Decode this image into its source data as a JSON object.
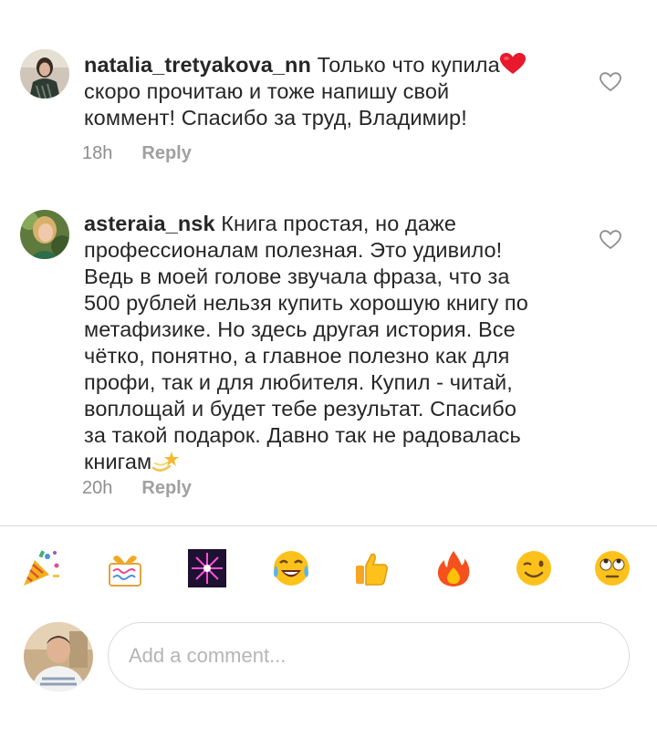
{
  "comments": [
    {
      "username": "natalia_tretyakova_nn",
      "text": " Только что купила",
      "text_emoji": "heart",
      "text_cont_lines": [
        "скоро прочитаю и тоже напишу свой",
        "коммент! Спасибо за труд, Владимир!"
      ],
      "time": "18h",
      "reply": "Reply"
    },
    {
      "username": "asteraia_nsk",
      "text_first": " Книга простая, но даже",
      "text_lines": [
        "профессионалам полезная. Это удивило!",
        "Ведь в моей голове звучала фраза, что за",
        "500 рублей нельзя купить хорошую книгу по",
        "метафизике. Но здесь другая история. Все",
        "чётко, понятно, а главное полезно как для",
        "профи, так и для любителя. Купил - читай,",
        "воплощай и будет тебе результат. Спасибо",
        "за такой подарок. Давно так не радовалась",
        "книгам"
      ],
      "text_emoji": "dizzy-star",
      "time": "20h",
      "reply": "Reply"
    }
  ],
  "reactions": [
    "party-popper",
    "wrapped-gift",
    "fireworks",
    "tears-of-joy",
    "thumbs-up",
    "fire",
    "winking-face",
    "eye-roll-face"
  ],
  "composer": {
    "placeholder": "Add a comment..."
  },
  "colors": {
    "text": "#262626",
    "muted": "#8e8e8e",
    "border": "#dbdbdb",
    "heart_red": "#e8192c"
  }
}
